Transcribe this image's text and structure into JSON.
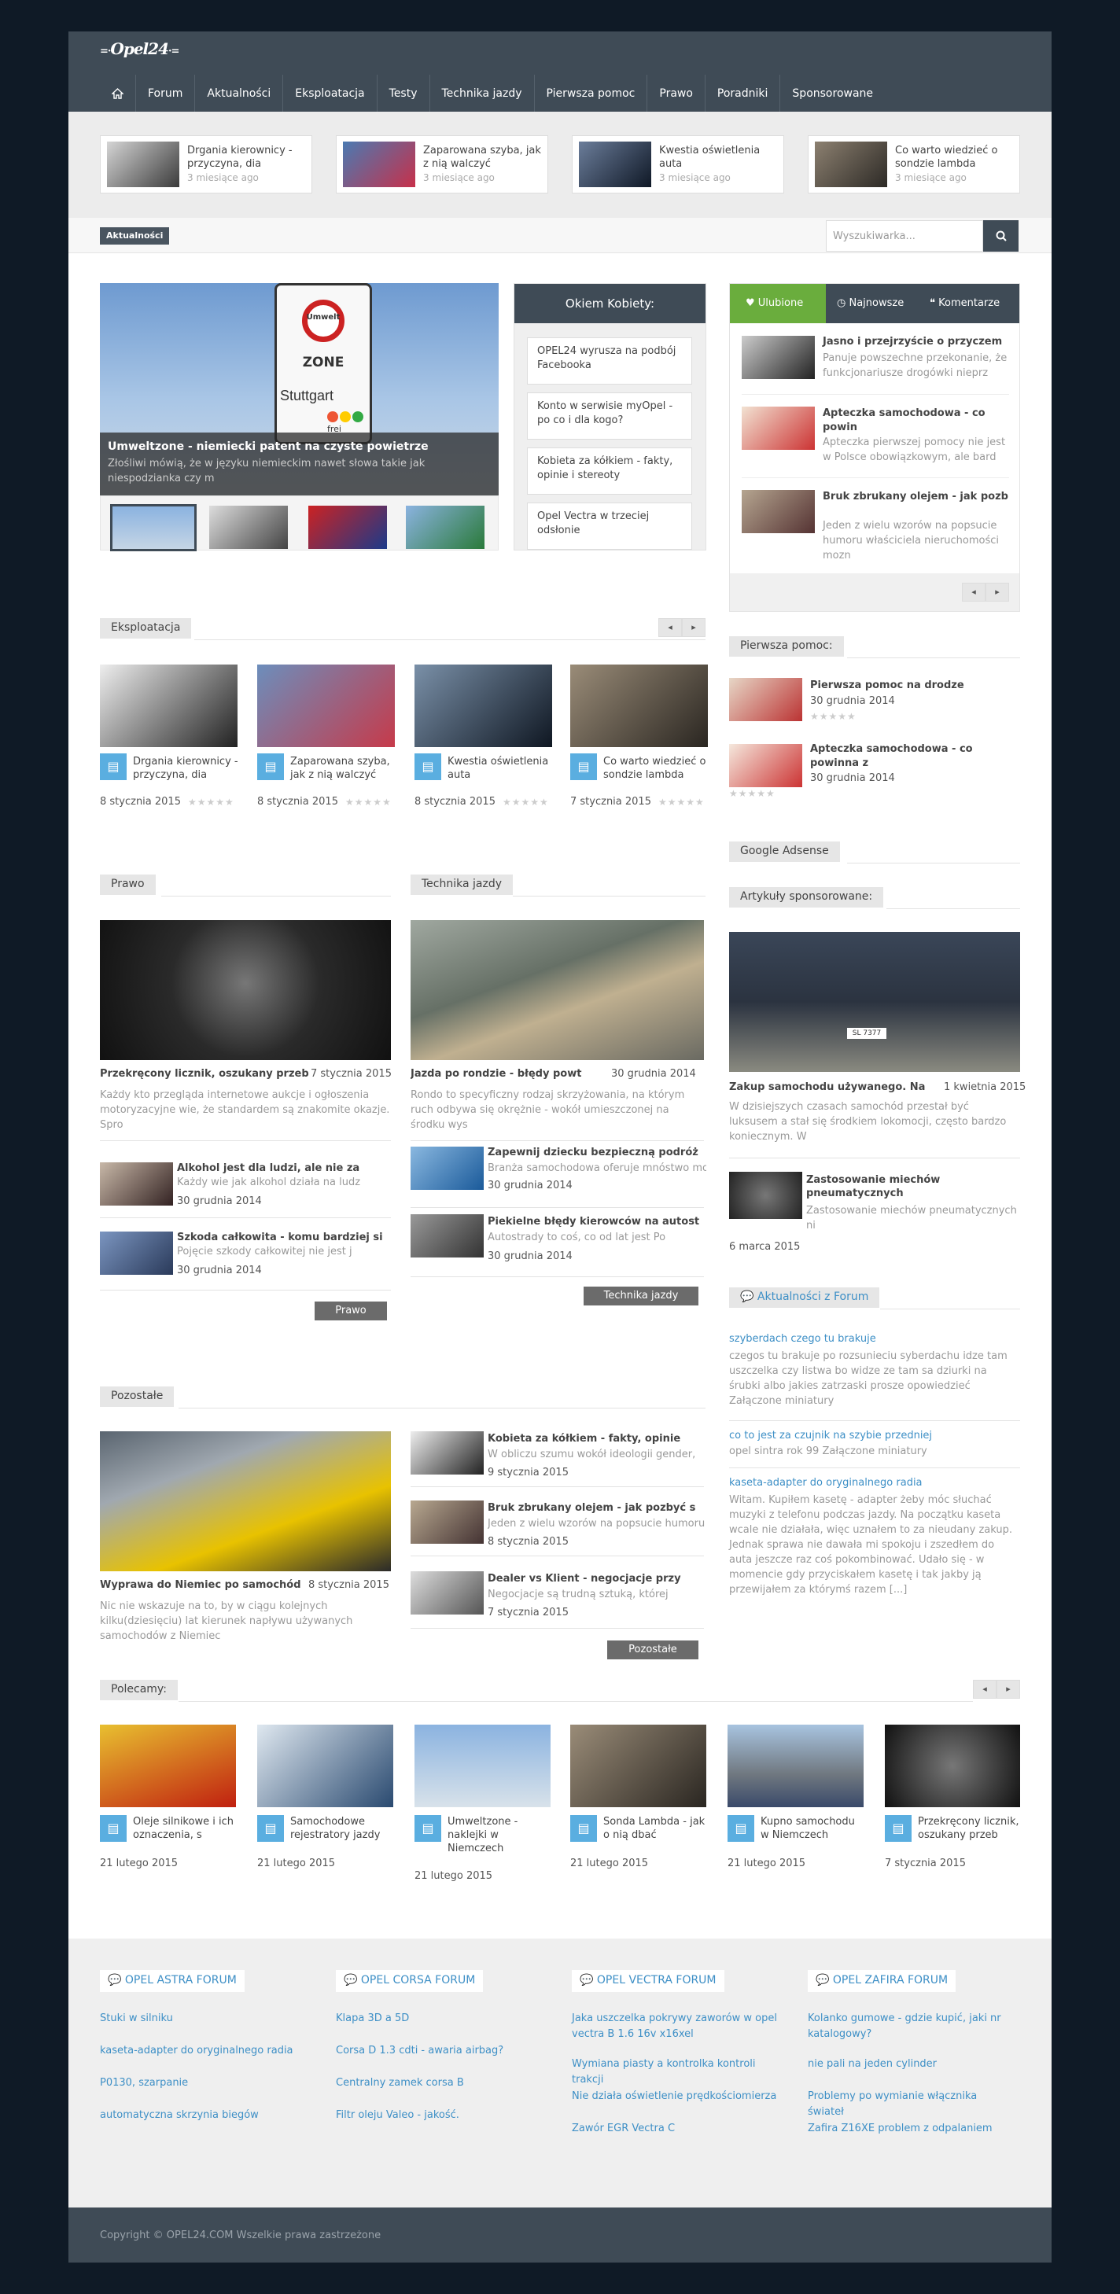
{
  "logo": "Opel24",
  "nav": [
    "Forum",
    "Aktualności",
    "Eksploatacja",
    "Testy",
    "Technika jazdy",
    "Pierwsza pomoc",
    "Prawo",
    "Poradniki",
    "Sponsorowane"
  ],
  "top_posts": [
    {
      "title": "Drgania kierownicy - przyczyna, dia",
      "date": "3 miesiące ago"
    },
    {
      "title": "Zaparowana szyba, jak z nią walczyć",
      "date": "3 miesiące ago"
    },
    {
      "title": "Kwestia oświetlenia auta",
      "date": "3 miesiące ago"
    },
    {
      "title": "Co warto wiedzieć o sondzie lambda",
      "date": "3 miesiące ago"
    }
  ],
  "ticker": {
    "label": "Aktualności",
    "search_placeholder": "Wyszukiwarka..."
  },
  "slider": {
    "title": "Umweltzone - niemiecki patent na czyste powietrze",
    "text": "Złośliwi mówią, że w języku niemieckim nawet słowa takie jak niespodzianka czy m",
    "sign": {
      "top": "Umwelt",
      "zone": "ZONE",
      "city": "Stuttgart",
      "frei": "frei"
    }
  },
  "okiem": {
    "title": "Okiem Kobiety:",
    "items": [
      "OPEL24 wyrusza na podbój Facebooka",
      "Konto w serwisie myOpel - po co i dla kogo?",
      "Kobieta za kółkiem - fakty, opinie i stereoty",
      "Opel Vectra w trzeciej odsłonie"
    ]
  },
  "tabs": {
    "t1": "Ulubione",
    "t2": "Najnowsze",
    "t3": "Komentarze",
    "items": [
      {
        "title": "Jasno i przejrzyście o przyczem",
        "text": "Panuje powszechne przekonanie, że funkcjonariusze drogówki nieprz"
      },
      {
        "title": "Apteczka samochodowa - co powin",
        "text": "Apteczka pierwszej pomocy nie jest w Polsce obowiązkowym, ale bard"
      },
      {
        "title": "Bruk zbrukany olejem - jak pozb",
        "text": "Jeden z wielu wzorów na popsucie humoru właściciela nieruchomości mozn"
      }
    ]
  },
  "eksploatacja": {
    "label": "Eksploatacja",
    "items": [
      {
        "title": "Drgania kierownicy - przyczyna, dia",
        "date": "8 stycznia 2015"
      },
      {
        "title": "Zaparowana szyba, jak z nią walczyć",
        "date": "8 stycznia 2015"
      },
      {
        "title": "Kwestia oświetlenia auta",
        "date": "8 stycznia 2015"
      },
      {
        "title": "Co warto wiedzieć o sondzie lambda",
        "date": "7 stycznia 2015"
      }
    ]
  },
  "pierwsza": {
    "label": "Pierwsza pomoc:",
    "items": [
      {
        "title": "Pierwsza pomoc na drodze",
        "date": "30 grudnia 2014"
      },
      {
        "title": "Apteczka samochodowa - co powinna z",
        "date": "30 grudnia 2014"
      }
    ]
  },
  "adsense": "Google Adsense",
  "sponsorowane": {
    "label": "Artykuły sponsorowane:",
    "plate": "SL 7377",
    "main": {
      "title": "Zakup samochodu używanego. Na",
      "date": "1 kwietnia 2015",
      "text": "W dzisiejszych czasach samochód przestał być luksusem a stał się środkiem lokomocji, często bardzo koniecznym. W"
    },
    "second": {
      "title": "Zastosowanie miechów pneumatycznych",
      "text": "Zastosowanie miechów pneumatycznych ni",
      "date": "6 marca 2015"
    }
  },
  "prawo": {
    "label": "Prawo",
    "main": {
      "title": "Przekręcony licznik, oszukany przeb",
      "date": "7 stycznia 2015",
      "text": "Każdy kto przegląda internetowe aukcje i ogłoszenia motoryzacyjne wie, że standardem są znakomite okazje. Spro"
    },
    "items": [
      {
        "title": "Alkohol jest dla ludzi, ale nie za",
        "text": "Każdy wie jak alkohol działa na ludz",
        "date": "30 grudnia 2014"
      },
      {
        "title": "Szkoda całkowita - komu bardziej si",
        "text": "Pojęcie szkody całkowitej nie jest j",
        "date": "30 grudnia 2014"
      }
    ],
    "button": "Prawo"
  },
  "technika": {
    "label": "Technika jazdy",
    "main": {
      "title": "Jazda po rondzie - błędy powt",
      "date": "30 grudnia 2014",
      "text": "Rondo to specyficzny rodzaj skrzyżowania, na którym ruch odbywa się okrężnie - wokół umieszczonej na środku wys"
    },
    "items": [
      {
        "title": "Zapewnij dziecku bezpieczną podróż",
        "text": "Branża samochodowa oferuje mnóstwo mo",
        "date": "30 grudnia 2014"
      },
      {
        "title": "Piekielne błędy kierowców na autost",
        "text": "Autostrady to coś, co od lat jest Po",
        "date": "30 grudnia 2014"
      }
    ],
    "button": "Technika jazdy"
  },
  "forum_news": {
    "label": "Aktualności z Forum",
    "items": [
      {
        "title": "szyberdach czego tu brakuje",
        "text": "czegos tu brakuje po rozsunieciu syberdachu idze tam uszczelka czy listwa bo widze ze tam sa dziurki na śrubki albo jakies zatrzaski prosze opowiedzieć Załączone miniatury"
      },
      {
        "title": "co to jest za czujnik na szybie przedniej",
        "text": "opel sintra rok 99 Załączone miniatury"
      },
      {
        "title": "kaseta-adapter do oryginalnego radia",
        "text": "Witam. Kupiłem kasetę - adapter żeby móc słuchać muzyki z telefonu podczas jazdy. Na początku kaseta wcale nie działała, więc uznałem to za nieudany zakup. Jednak sprawa nie dawała mi spokoju i zszedłem do auta jeszcze raz coś pokombinować. Udało się - w momencie gdy przyciskałem kasetę i tak jakby ją przewijałem za którymś razem [...]"
      }
    ]
  },
  "pozostale": {
    "label": "Pozostałe",
    "main": {
      "title": "Wyprawa do Niemiec po samochód",
      "date": "8 stycznia 2015",
      "text": "Nic nie wskazuje na to, by w ciągu kolejnych kilku(dziesięciu) lat kierunek napływu używanych samochodów z Niemiec"
    },
    "items": [
      {
        "title": "Kobieta za kółkiem - fakty, opinie",
        "text": "W obliczu szumu wokół ideologii gender,",
        "date": "9 stycznia 2015"
      },
      {
        "title": "Bruk zbrukany olejem - jak pozbyć s",
        "text": "Jeden z wielu wzorów na popsucie humoru",
        "date": "8 stycznia 2015"
      },
      {
        "title": "Dealer vs Klient - negocjacje przy",
        "text": "Negocjacje są trudną sztuką, której",
        "date": "7 stycznia 2015"
      }
    ],
    "button": "Pozostałe"
  },
  "polecamy": {
    "label": "Polecamy:",
    "items": [
      {
        "title": "Oleje silnikowe i ich oznaczenia, s",
        "date": "21 lutego 2015"
      },
      {
        "title": "Samochodowe rejestratory jazdy",
        "date": "21 lutego 2015"
      },
      {
        "title": "Umweltzone - naklejki w Niemczech",
        "date": "21 lutego 2015"
      },
      {
        "title": "Sonda Lambda - jak o nią dbać",
        "date": "21 lutego 2015"
      },
      {
        "title": "Kupno samochodu w Niemczech",
        "date": "21 lutego 2015"
      },
      {
        "title": "Przekręcony licznik, oszukany przeb",
        "date": "7 stycznia 2015"
      }
    ]
  },
  "footer": {
    "cols": [
      {
        "title": "OPEL ASTRA FORUM",
        "links": [
          "Stuki w silniku",
          "kaseta-adapter do oryginalnego radia",
          "P0130, szarpanie",
          "automatyczna skrzynia biegów"
        ]
      },
      {
        "title": "OPEL CORSA FORUM",
        "links": [
          "Klapa 3D a 5D",
          "Corsa D 1.3 cdti - awaria airbag?",
          "Centralny zamek corsa B",
          "Filtr oleju Valeo - jakość."
        ]
      },
      {
        "title": "OPEL VECTRA FORUM",
        "links": [
          "Jaka uszczelka pokrywy zaworów w opel vectra B 1.6 16v x16xel",
          "Wymiana piasty a kontrolka kontroli trakcji",
          "Nie działa oświetlenie prędkościomierza",
          "Zawór EGR Vectra C"
        ]
      },
      {
        "title": "OPEL ZAFIRA FORUM",
        "links": [
          "Kolanko gumowe - gdzie kupić, jaki nr katalogowy?",
          "nie pali na jeden cylinder",
          "Problemy po wymianie włącznika świateł",
          "Zafira Z16XE problem z odpalaniem"
        ]
      }
    ],
    "copyright": "Copyright © OPEL24.COM Wszelkie prawa zastrzeżone"
  }
}
